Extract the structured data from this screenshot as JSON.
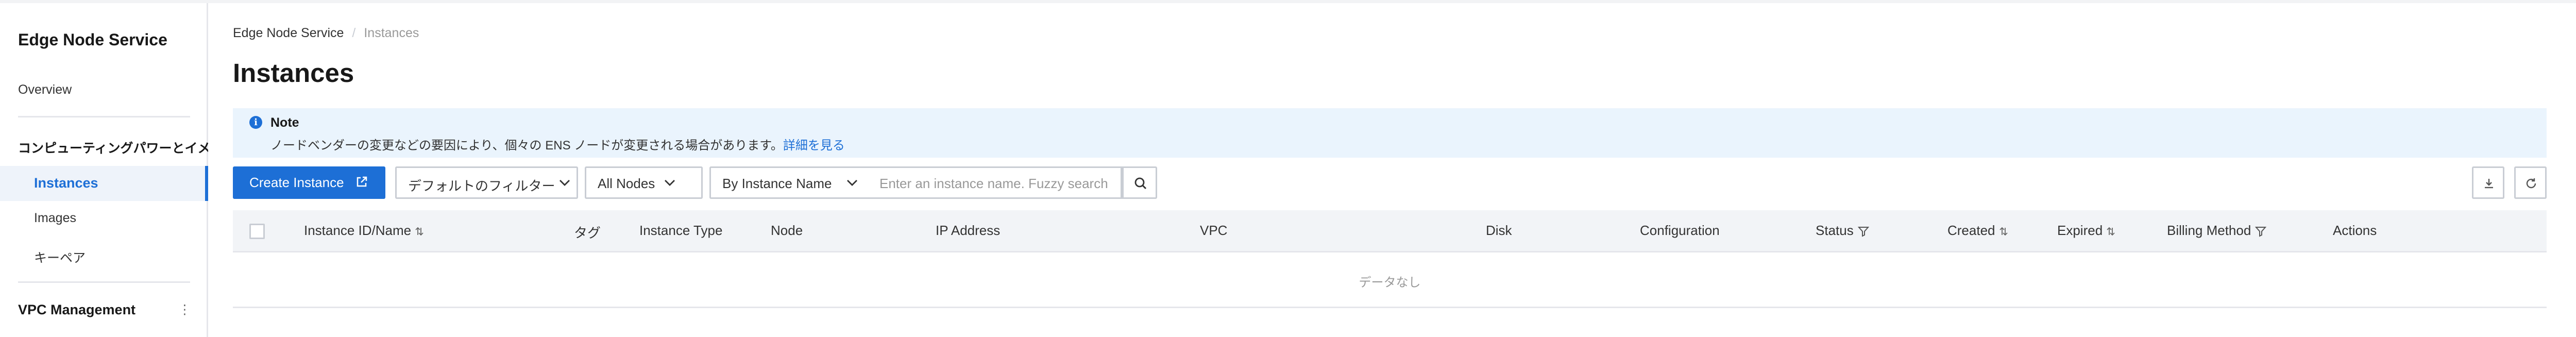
{
  "sidebar": {
    "title": "Edge Node Service",
    "overview": "Overview",
    "group_label": "コンピューティングパワーとイメ-",
    "items": [
      {
        "label": "Instances"
      },
      {
        "label": "Images"
      },
      {
        "label": "キーペア"
      }
    ],
    "vpc_label": "VPC Management",
    "vpc_menu": "⋮"
  },
  "breadcrumb": {
    "root": "Edge Node Service",
    "separator": "/",
    "current": "Instances"
  },
  "page_title": "Instances",
  "note": {
    "icon": "i",
    "title": "Note",
    "text": "ノードベンダーの変更などの要因により、個々の ENS ノードが変更される場合があります。",
    "link": "詳細を見る"
  },
  "toolbar": {
    "create_label": "Create Instance",
    "filter_label": "デフォルトのフィルター",
    "nodes_label": "All Nodes",
    "search_type_label": "By Instance Name",
    "search_placeholder": "Enter an instance name. Fuzzy search"
  },
  "table": {
    "columns": [
      {
        "label": "Instance ID/Name",
        "icon": "sort"
      },
      {
        "label": "タグ",
        "icon": ""
      },
      {
        "label": "Instance Type",
        "icon": ""
      },
      {
        "label": "Node",
        "icon": ""
      },
      {
        "label": "IP Address",
        "icon": ""
      },
      {
        "label": "VPC",
        "icon": ""
      },
      {
        "label": "Disk",
        "icon": ""
      },
      {
        "label": "Configuration",
        "icon": ""
      },
      {
        "label": "Status",
        "icon": "filter"
      },
      {
        "label": "Created",
        "icon": "sort"
      },
      {
        "label": "Expired",
        "icon": "sort"
      },
      {
        "label": "Billing Method",
        "icon": "filter"
      },
      {
        "label": "Actions",
        "icon": ""
      }
    ],
    "empty_text": "データなし"
  },
  "colors": {
    "accent": "#1d6fd6",
    "note_bg": "#eaf4fd",
    "header_bg": "#f2f4f7"
  }
}
